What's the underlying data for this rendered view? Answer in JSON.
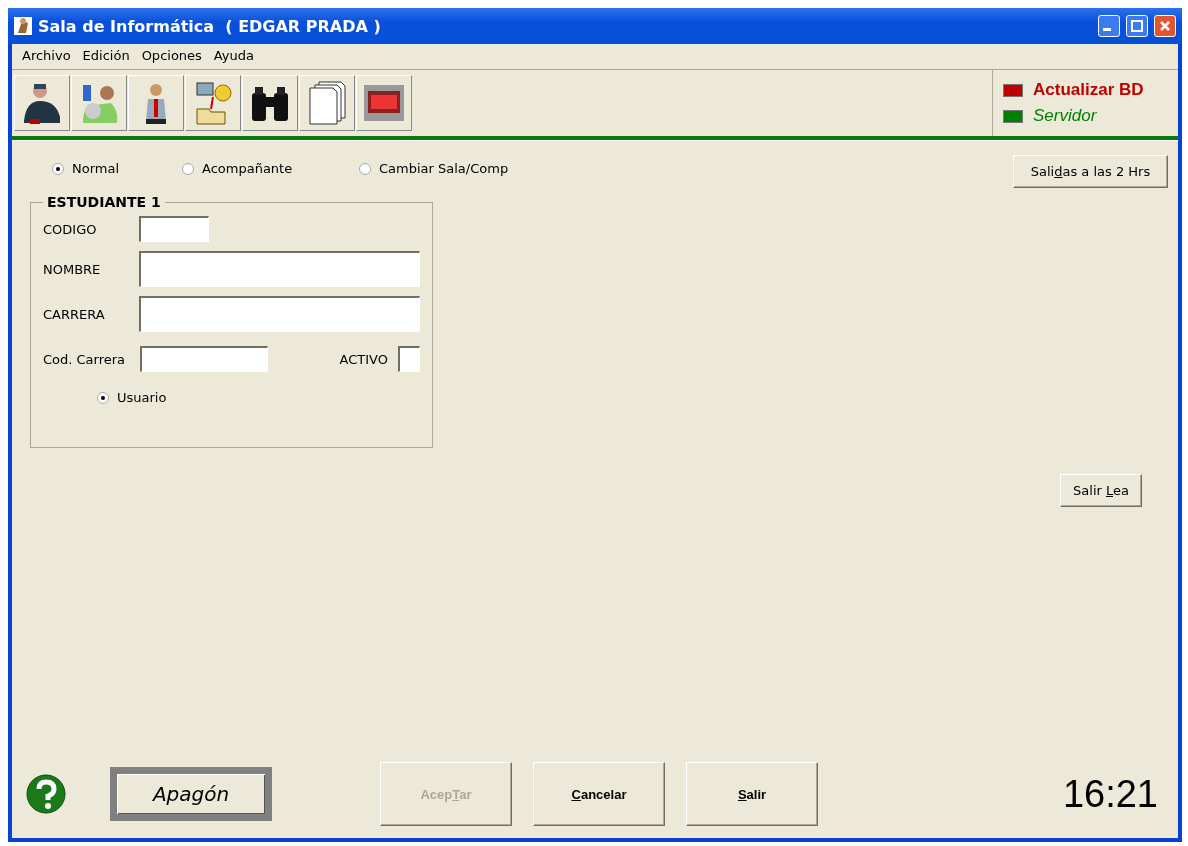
{
  "window": {
    "title": "Sala de Informática  ( EDGAR PRADA )"
  },
  "menu": [
    "Archivo",
    "Edición",
    "Opciones",
    "Ayuda"
  ],
  "toolbar": [
    {
      "kind": "officer"
    },
    {
      "kind": "students"
    },
    {
      "kind": "man"
    },
    {
      "kind": "computer"
    },
    {
      "kind": "binoculars"
    },
    {
      "kind": "documents"
    },
    {
      "kind": "exit"
    }
  ],
  "indicators": [
    {
      "label": "Actualizar BD",
      "color": "#c00000",
      "kind": "bold"
    },
    {
      "label": "Servidor",
      "color": "#008000",
      "kind": "italic"
    }
  ],
  "modes": [
    {
      "label": "Normal",
      "selected": true
    },
    {
      "label": "Acompañante",
      "selected": false
    },
    {
      "label": "Cambiar Sala/Comp",
      "selected": false
    }
  ],
  "salidas_button": {
    "label_parts": {
      "before": "Sali",
      "key": "d",
      "after": "as a las 2 Hrs"
    }
  },
  "student": {
    "title": "ESTUDIANTE 1",
    "codigo": {
      "label": "CODIGO"
    },
    "nombre": {
      "label": "NOMBRE"
    },
    "carrera": {
      "label": "CARRERA"
    },
    "cod_carrera": {
      "label": "Cod.  Carrera"
    },
    "activo": {
      "label": "ACTIVO",
      "checked": false
    },
    "usuario": {
      "label": "Usuario",
      "selected": true
    }
  },
  "salir_lea_button": {
    "label_parts": {
      "before": "Salir ",
      "key": "L",
      "after": "ea"
    }
  },
  "apagon_button": {
    "label": "Apagón"
  },
  "buttons": [
    {
      "label_parts": {
        "before": "Acep",
        "key": "T",
        "after": "ar"
      },
      "disabled": true
    },
    {
      "label_parts": {
        "key": "C",
        "after": "ancelar"
      },
      "disabled": false
    },
    {
      "label_parts": {
        "key": "S",
        "after": "alir"
      },
      "disabled": false
    }
  ],
  "clock": "16:21"
}
